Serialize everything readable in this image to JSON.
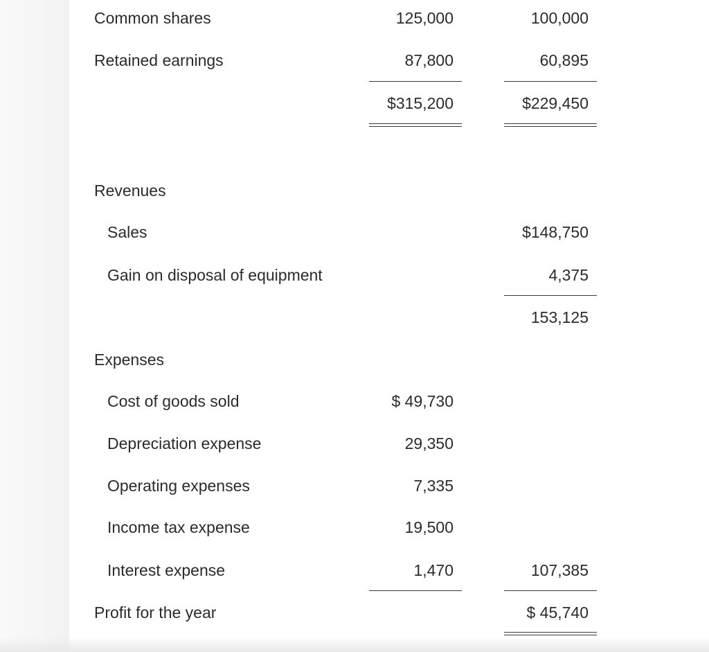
{
  "balance_sheet_tail": {
    "rows": [
      {
        "label": "Common shares",
        "col1": "125,000",
        "col2": "100,000"
      },
      {
        "label": "Retained earnings",
        "col1": "87,800",
        "col2": "60,895"
      },
      {
        "label": "",
        "col1": "$315,200",
        "col2": "$229,450"
      }
    ]
  },
  "income_statement": {
    "revenues": {
      "heading": "Revenues",
      "items": [
        {
          "label": "Sales",
          "value": "$148,750"
        },
        {
          "label": "Gain on disposal of equipment",
          "value": "4,375"
        }
      ],
      "total": "153,125"
    },
    "expenses": {
      "heading": "Expenses",
      "items": [
        {
          "label": "Cost of goods sold",
          "value": "$ 49,730"
        },
        {
          "label": "Depreciation expense",
          "value": "29,350"
        },
        {
          "label": "Operating expenses",
          "value": "7,335"
        },
        {
          "label": "Income tax expense",
          "value": "19,500"
        },
        {
          "label": "Interest expense",
          "value": "1,470"
        }
      ],
      "total": "107,385"
    },
    "profit": {
      "label": "Profit for the year",
      "value": "$ 45,740"
    }
  }
}
